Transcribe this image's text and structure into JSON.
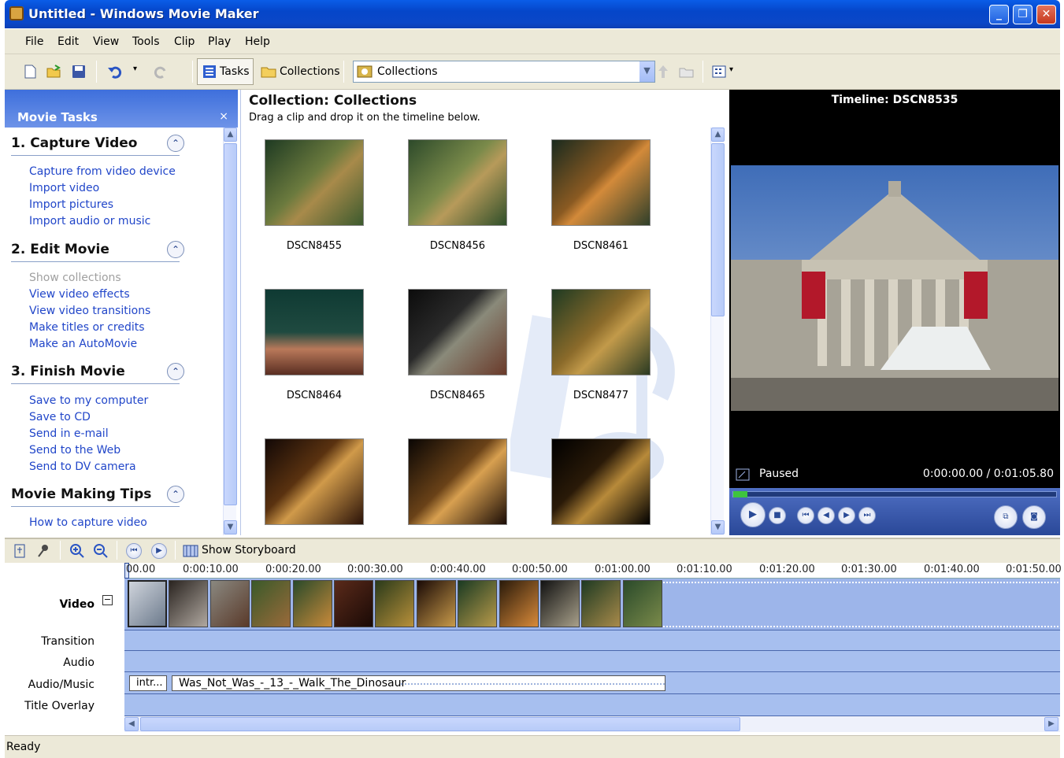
{
  "window": {
    "title": "Untitled - Windows Movie Maker",
    "controls": {
      "minimize": "_",
      "maximize": "❐",
      "close": "✕"
    }
  },
  "menu": [
    "File",
    "Edit",
    "View",
    "Tools",
    "Clip",
    "Play",
    "Help"
  ],
  "toolbar": {
    "tasks_label": "Tasks",
    "collections_label": "Collections",
    "combo_value": "Collections"
  },
  "tasks_pane": {
    "title": "Movie Tasks",
    "close": "×",
    "sections": [
      {
        "title": "1. Capture Video",
        "links": [
          "Capture from video device",
          "Import video",
          "Import pictures",
          "Import audio or music"
        ]
      },
      {
        "title": "2. Edit Movie",
        "links": [
          "Show collections",
          "View video effects",
          "View video transitions",
          "Make titles or credits",
          "Make an AutoMovie"
        ]
      },
      {
        "title": "3. Finish Movie",
        "links": [
          "Save to my computer",
          "Save to CD",
          "Send in e-mail",
          "Send to the Web",
          "Send to DV camera"
        ]
      },
      {
        "title": "Movie Making Tips",
        "links": [
          "How to capture video"
        ]
      }
    ]
  },
  "collection": {
    "title": "Collection: Collections",
    "subtitle": "Drag a clip and drop it on the timeline below.",
    "clips": [
      "DSCN8455",
      "DSCN8456",
      "DSCN8461",
      "DSCN8464",
      "DSCN8465",
      "DSCN8477",
      "",
      "",
      ""
    ]
  },
  "preview": {
    "title": "Timeline: DSCN8535",
    "status": "Paused",
    "time": "0:00:00.00 / 0:01:05.80"
  },
  "timeline": {
    "show_storyboard": "Show Storyboard",
    "ruler": [
      "00.00",
      "0:00:10.00",
      "0:00:20.00",
      "0:00:30.00",
      "0:00:40.00",
      "0:00:50.00",
      "0:01:00.00",
      "0:01:10.00",
      "0:01:20.00",
      "0:01:30.00",
      "0:01:40.00",
      "0:01:50.00"
    ],
    "tracks": {
      "video": "Video",
      "transition": "Transition",
      "audio": "Audio",
      "audio_music": "Audio/Music",
      "title_overlay": "Title Overlay"
    },
    "audio_clips": [
      "intr...",
      "Was_Not_Was_-_13_-_Walk_The_Dinosaur"
    ],
    "video_clip_count": 13
  },
  "status": "Ready"
}
